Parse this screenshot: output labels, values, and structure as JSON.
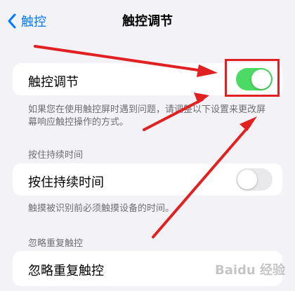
{
  "nav": {
    "back_label": "触控",
    "title": "触控调节"
  },
  "main_setting": {
    "label": "触控调节",
    "state": "on",
    "footer": "如果您在使用触控屏时遇到问题，请调整以下设置来更改屏幕响应触控操作的方式。"
  },
  "hold_duration": {
    "section_header": "按住持续时间",
    "label": "按住持续时间",
    "state": "off",
    "footer": "触摸被识别前必须触摸设备的时间。"
  },
  "ignore_repeat": {
    "section_header": "忽略重复触控",
    "label": "忽略重复触控"
  },
  "colors": {
    "accent": "#007aff",
    "toggle_on": "#4cd964",
    "toggle_off": "#e9e9eb",
    "annotation": "#e12121"
  },
  "watermark": "Baidu 经验"
}
